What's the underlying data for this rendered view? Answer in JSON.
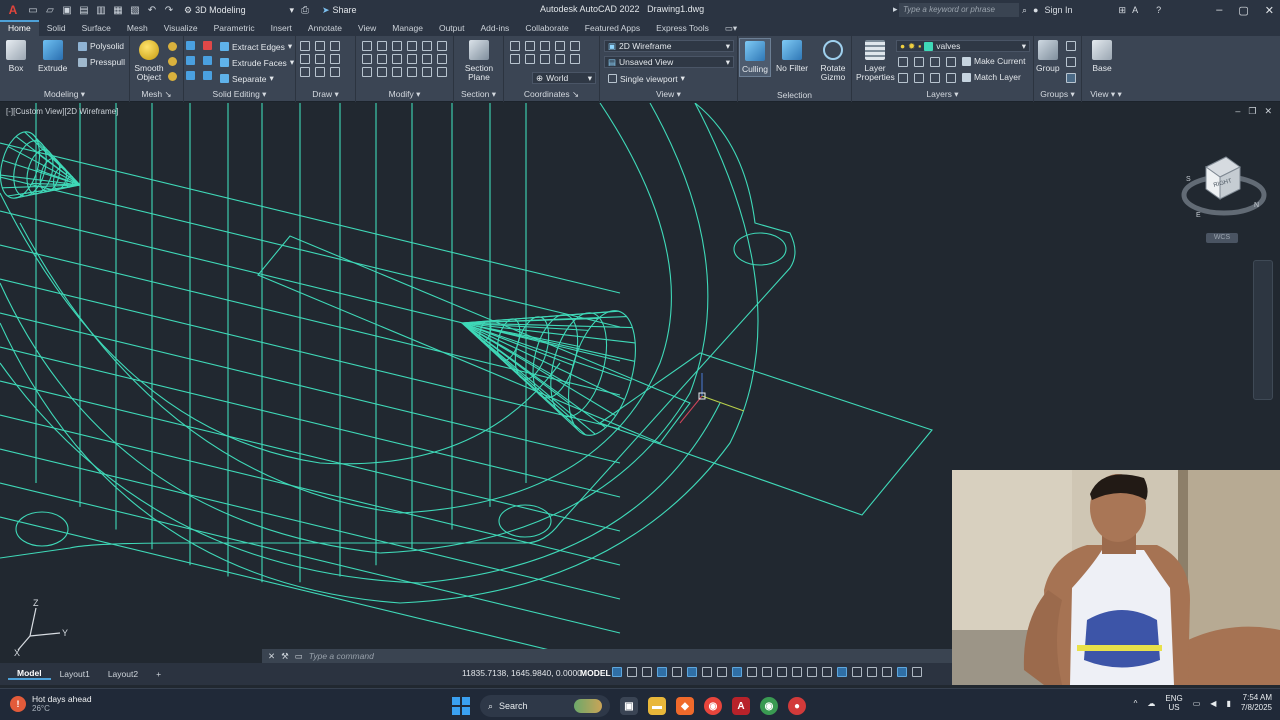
{
  "titlebar": {
    "logo": "A",
    "workspace": "3D Modeling",
    "share": "Share",
    "title": "Autodesk AutoCAD 2022",
    "filename": "Drawing1.dwg",
    "search_placeholder": "Type a keyword or phrase",
    "sign_in": "Sign In"
  },
  "ribbon": {
    "tabs": [
      "Home",
      "Solid",
      "Surface",
      "Mesh",
      "Visualize",
      "Parametric",
      "Insert",
      "Annotate",
      "View",
      "Manage",
      "Output",
      "Add-ins",
      "Collaborate",
      "Featured Apps",
      "Express Tools"
    ],
    "active_tab": "Home",
    "modeling": {
      "title": "Modeling",
      "box": "Box",
      "extrude": "Extrude",
      "polysolid": "Polysolid",
      "presspull": "Presspull"
    },
    "mesh": {
      "title": "Mesh",
      "smooth": "Smooth Object"
    },
    "solid_editing": {
      "title": "Solid Editing",
      "extract_edges": "Extract Edges",
      "extrude_faces": "Extrude Faces",
      "separate": "Separate"
    },
    "draw": {
      "title": "Draw"
    },
    "modify": {
      "title": "Modify"
    },
    "section": {
      "title": "Section",
      "plane": "Section Plane"
    },
    "coordinates": {
      "title": "Coordinates",
      "world": "World"
    },
    "view": {
      "title": "View",
      "visual_style": "2D Wireframe",
      "saved_view": "Unsaved View",
      "viewport": "Single viewport"
    },
    "selection": {
      "title": "Selection",
      "culling": "Culling",
      "no_filter": "No Filter",
      "rotate_gizmo": "Rotate Gizmo"
    },
    "layers": {
      "title": "Layers",
      "layer_properties": "Layer Properties",
      "layer_name": "valves",
      "make_current": "Make Current",
      "match_layer": "Match Layer"
    },
    "groups": {
      "title": "Groups",
      "group": "Group"
    },
    "view2": {
      "title": "View",
      "base": "Base"
    }
  },
  "viewport": {
    "label": "[-][Custom View][2D Wireframe]",
    "viewcube_face": "RIGHT",
    "compass": [
      "S",
      "E",
      "N"
    ],
    "wcs": "WCS",
    "ucs": [
      "Z",
      "Y",
      "X"
    ]
  },
  "command": {
    "placeholder": "Type a command"
  },
  "layout_tabs": [
    "Model",
    "Layout1",
    "Layout2"
  ],
  "status": {
    "coords": "11835.7138, 1645.9840, 0.0000",
    "model": "MODEL"
  },
  "taskbar": {
    "weather_title": "Hot days ahead",
    "weather_temp": "26°C",
    "search": "Search",
    "lang": "ENG",
    "region": "US",
    "time": "7:54 AM",
    "date": "7/8/2025"
  },
  "colors": {
    "wire": "#3fd9b8",
    "accent": "#4ea1d8",
    "bg": "#212830"
  }
}
